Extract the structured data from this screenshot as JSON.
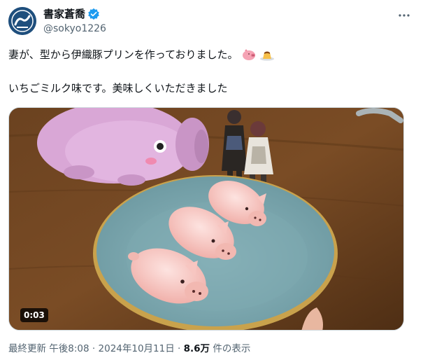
{
  "author": {
    "display_name": "書家蒼喬",
    "handle": "@sokyo1226",
    "verified": true
  },
  "tweet": {
    "line1": "妻が、型から伊織豚プリンを作っておりました。",
    "line2": "いちごミルク味です。美味しくいただきました",
    "emojis": [
      "pig-nose-icon",
      "pudding-icon"
    ]
  },
  "media": {
    "type": "video",
    "duration": "0:03"
  },
  "meta": {
    "updated_label": "最終更新",
    "time": "午後8:08",
    "separator": "·",
    "date": "2024年10月11日",
    "views_count": "8.6万",
    "views_label": "件の表示"
  },
  "colors": {
    "brand_blue": "#1d9bf0",
    "text_primary": "#0f1419",
    "text_secondary": "#536471"
  }
}
